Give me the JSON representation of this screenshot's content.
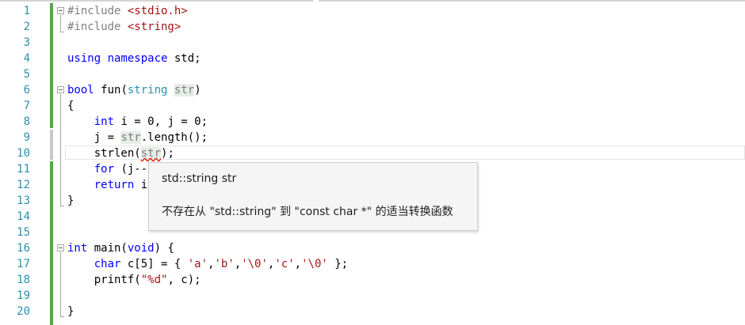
{
  "editor": {
    "language": "cpp",
    "lines": [
      {
        "num": "1",
        "tokens": [
          {
            "t": "#include ",
            "c": "pp"
          },
          {
            "t": "<stdio.h>",
            "c": "str"
          }
        ]
      },
      {
        "num": "2",
        "tokens": [
          {
            "t": "#include ",
            "c": "pp"
          },
          {
            "t": "<string>",
            "c": "str"
          }
        ]
      },
      {
        "num": "3",
        "tokens": []
      },
      {
        "num": "4",
        "tokens": [
          {
            "t": "using ",
            "c": "kw"
          },
          {
            "t": "namespace ",
            "c": "kw"
          },
          {
            "t": "std;",
            "c": ""
          }
        ]
      },
      {
        "num": "5",
        "tokens": []
      },
      {
        "num": "6",
        "tokens": [
          {
            "t": "bool ",
            "c": "kw"
          },
          {
            "t": "fun(",
            "c": ""
          },
          {
            "t": "string ",
            "c": "ty"
          },
          {
            "t": "str",
            "c": "param"
          },
          {
            "t": ")",
            "c": ""
          }
        ]
      },
      {
        "num": "7",
        "tokens": [
          {
            "t": "{",
            "c": ""
          }
        ]
      },
      {
        "num": "8",
        "tokens": [
          {
            "t": "    ",
            "c": ""
          },
          {
            "t": "int ",
            "c": "kw"
          },
          {
            "t": "i = 0, j = 0;",
            "c": ""
          }
        ]
      },
      {
        "num": "9",
        "tokens": [
          {
            "t": "    j = ",
            "c": ""
          },
          {
            "t": "str",
            "c": "param"
          },
          {
            "t": ".length();",
            "c": ""
          }
        ]
      },
      {
        "num": "10",
        "tokens": [
          {
            "t": "    strlen(",
            "c": ""
          },
          {
            "t": "str",
            "c": "param squig"
          },
          {
            "t": ");",
            "c": ""
          }
        ]
      },
      {
        "num": "11",
        "tokens": [
          {
            "t": "    ",
            "c": ""
          },
          {
            "t": "for ",
            "c": "kw"
          },
          {
            "t": "(j--;",
            "c": ""
          }
        ]
      },
      {
        "num": "12",
        "tokens": [
          {
            "t": "    ",
            "c": ""
          },
          {
            "t": "return ",
            "c": "kw"
          },
          {
            "t": "i",
            "c": ""
          }
        ]
      },
      {
        "num": "13",
        "tokens": [
          {
            "t": "}",
            "c": ""
          }
        ]
      },
      {
        "num": "14",
        "tokens": []
      },
      {
        "num": "15",
        "tokens": []
      },
      {
        "num": "16",
        "tokens": [
          {
            "t": "int ",
            "c": "kw"
          },
          {
            "t": "main(",
            "c": ""
          },
          {
            "t": "void",
            "c": "kw"
          },
          {
            "t": ") {",
            "c": ""
          }
        ]
      },
      {
        "num": "17",
        "tokens": [
          {
            "t": "    ",
            "c": ""
          },
          {
            "t": "char ",
            "c": "kw"
          },
          {
            "t": "c[5] = { ",
            "c": ""
          },
          {
            "t": "'a'",
            "c": "str"
          },
          {
            "t": ",",
            "c": ""
          },
          {
            "t": "'b'",
            "c": "str"
          },
          {
            "t": ",",
            "c": ""
          },
          {
            "t": "'\\0'",
            "c": "str"
          },
          {
            "t": ",",
            "c": ""
          },
          {
            "t": "'c'",
            "c": "str"
          },
          {
            "t": ",",
            "c": ""
          },
          {
            "t": "'\\0'",
            "c": "str"
          },
          {
            "t": " };",
            "c": ""
          }
        ]
      },
      {
        "num": "18",
        "tokens": [
          {
            "t": "    printf(",
            "c": ""
          },
          {
            "t": "\"%d\"",
            "c": "str"
          },
          {
            "t": ", c);",
            "c": ""
          }
        ]
      },
      {
        "num": "19",
        "tokens": []
      },
      {
        "num": "20",
        "tokens": [
          {
            "t": "}",
            "c": ""
          }
        ]
      }
    ]
  },
  "tooltip": {
    "signature": "std::string str",
    "message": "不存在从 \"std::string\" 到 \"const char *\" 的适当转换函数"
  }
}
